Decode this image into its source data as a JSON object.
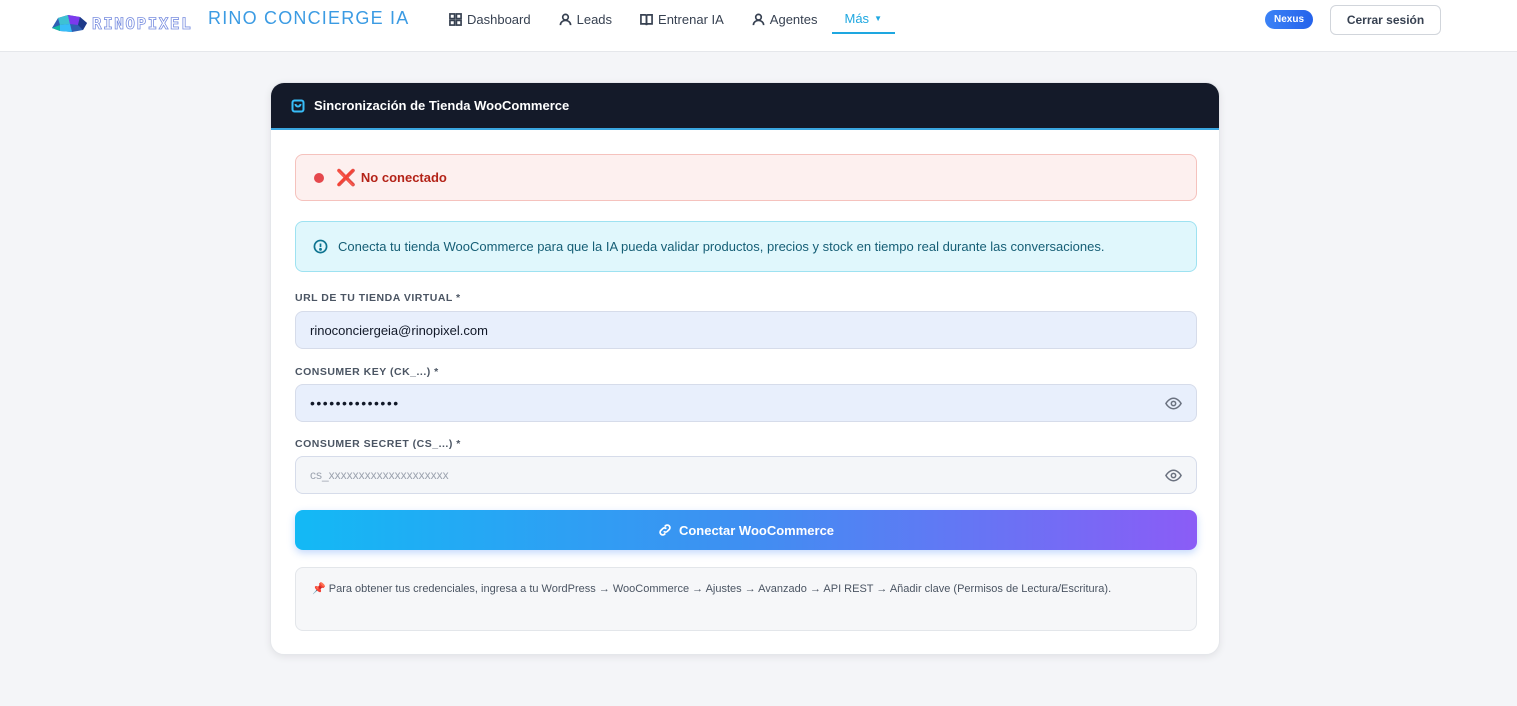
{
  "header": {
    "logo_text": "RINOPIXEL",
    "app_title": "RINO CONCIERGE IA",
    "nav": [
      {
        "label": "Dashboard",
        "icon": "grid-icon"
      },
      {
        "label": "Leads",
        "icon": "user-icon"
      },
      {
        "label": "Entrenar IA",
        "icon": "book-icon"
      },
      {
        "label": "Agentes",
        "icon": "user-icon"
      }
    ],
    "more_label": "Más",
    "badge": "Nexus",
    "logout_label": "Cerrar sesión"
  },
  "card": {
    "title": "Sincronización de Tienda WooCommerce",
    "status": {
      "icon": "❌",
      "text": "No conectado",
      "color": "#e5484d"
    },
    "info_text": "Conecta tu tienda WooCommerce para que la IA pueda validar productos, precios y stock en tiempo real durante las conversaciones.",
    "fields": {
      "url_label": "URL DE TU TIENDA VIRTUAL *",
      "url_value": "rinoconciergeia@rinopixel.com",
      "key_label": "CONSUMER KEY (CK_...) *",
      "key_value": "••••••••••••••",
      "secret_label": "CONSUMER SECRET (CS_...) *",
      "secret_placeholder": "cs_xxxxxxxxxxxxxxxxxxxx"
    },
    "connect_label": "Conectar WooCommerce",
    "note_pin": "📌",
    "note_text": "Para obtener tus credenciales, ingresa a tu WordPress → WooCommerce → Ajustes → Avanzado → API REST → Añadir clave (Permisos de Lectura/Escritura)."
  }
}
